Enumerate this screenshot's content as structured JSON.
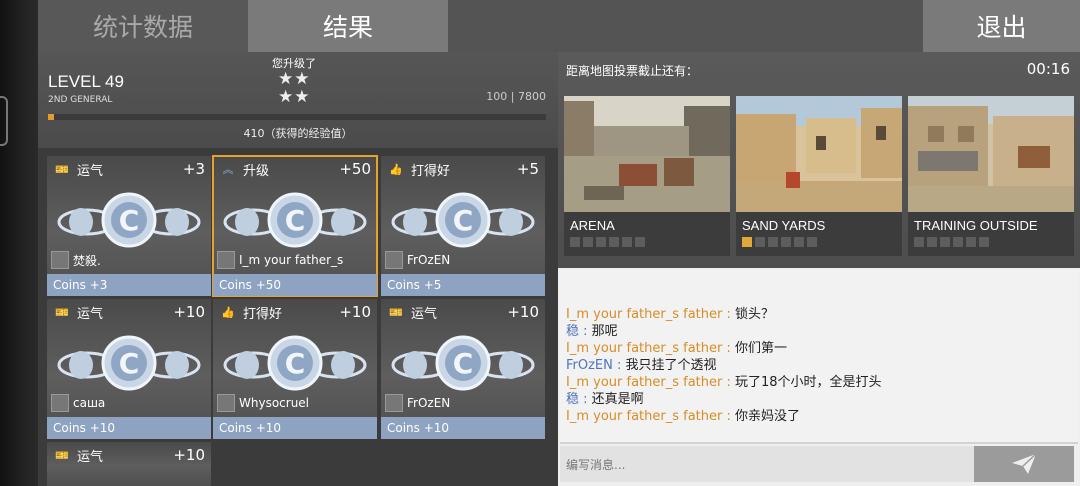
{
  "tabs": {
    "stats": "统计数据",
    "results": "结果",
    "exit": "退出"
  },
  "level": {
    "levelup_text": "您升级了",
    "title": "LEVEL 49",
    "rank": "2ND GENERAL",
    "stars": "★★\n★★",
    "xp_range": "100 | 7800",
    "xp_progress": 0.013,
    "xp_gained": "410（获得的经验值）"
  },
  "rewards": [
    {
      "label": "运气",
      "value": "+3",
      "icon": "ticket-icon",
      "player": "焚殺.",
      "coins": "Coins +3"
    },
    {
      "label": "升级",
      "value": "+50",
      "icon": "chevron-up-icon",
      "player": "I_m your father_s",
      "coins": "Coins +50",
      "highlighted": true
    },
    {
      "label": "打得好",
      "value": "+5",
      "icon": "thumbs-up-icon",
      "player": "FrOzEN",
      "coins": "Coins +5"
    },
    {
      "label": "运气",
      "value": "+10",
      "icon": "ticket-icon",
      "player": "саша",
      "coins": "Coins +10"
    },
    {
      "label": "打得好",
      "value": "+10",
      "icon": "thumbs-up-icon",
      "player": "Whysocruel",
      "coins": "Coins +10"
    },
    {
      "label": "运气",
      "value": "+10",
      "icon": "ticket-icon",
      "player": "FrOzEN",
      "coins": "Coins +10"
    },
    {
      "label": "运气",
      "value": "+10",
      "icon": "ticket-icon"
    }
  ],
  "map_vote": {
    "label": "距离地图投票截止还有：",
    "timer": "00:16",
    "maps": [
      {
        "name": "ARENA",
        "votes": 0
      },
      {
        "name": "SAND YARDS",
        "votes": 1
      },
      {
        "name": "TRAINING OUTSIDE",
        "votes": 0
      }
    ]
  },
  "chat": {
    "messages": [
      {
        "name": "I_m your father_s father",
        "color": "#d88d24",
        "text": "锁头？"
      },
      {
        "name": "稳",
        "color": "#4e73bd",
        "text": "那呢"
      },
      {
        "name": "I_m your father_s father",
        "color": "#d88d24",
        "text": "你们第一"
      },
      {
        "name": "FrOzEN",
        "color": "#4e73bd",
        "text": "我只挂了个透视"
      },
      {
        "name": "I_m your father_s father",
        "color": "#d88d24",
        "text": "玩了18个小时，全是打头"
      },
      {
        "name": "稳",
        "color": "#4e73bd",
        "text": "还真是啊"
      },
      {
        "name": "I_m your father_s father",
        "color": "#d88d24",
        "text": "你亲妈没了"
      }
    ],
    "separator": " : ",
    "input_placeholder": "编写消息..."
  },
  "colors": {
    "accent": "#e5a32c",
    "coins_bar": "#8ea3c1"
  }
}
